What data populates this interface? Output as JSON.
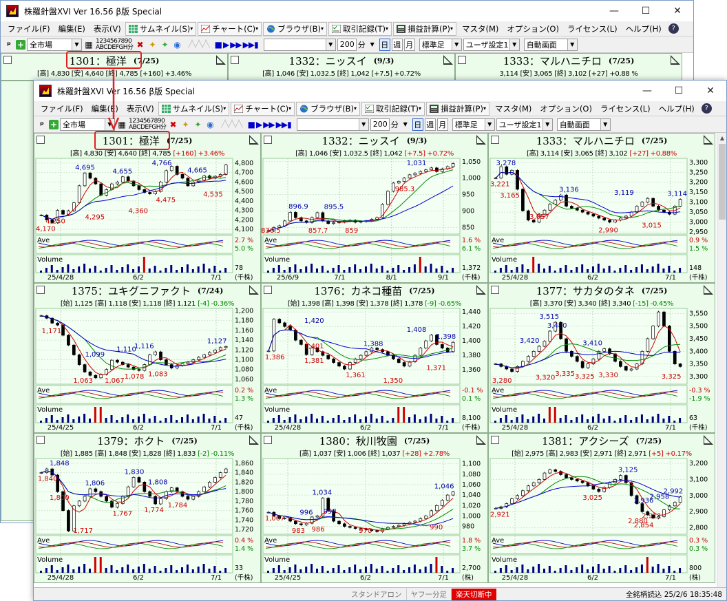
{
  "app": {
    "title": "株羅針盤XVI Ver 16.56 β版  Special",
    "controls": {
      "minimize": "—",
      "maximize": "☐",
      "close": "✕"
    }
  },
  "menus": [
    {
      "label": "ファイル(F)",
      "icon": null
    },
    {
      "label": "編集(E)",
      "icon": null
    },
    {
      "label": "表示(V)",
      "icon": null
    },
    {
      "label": "サムネイル(S)",
      "icon": "grid-icon"
    },
    {
      "label": "チャート(C)",
      "icon": "chart-icon"
    },
    {
      "label": "ブラウザ(B)",
      "icon": "globe-icon"
    },
    {
      "label": "取引記録(T)",
      "icon": "checklist-icon"
    },
    {
      "label": "損益計算(P)",
      "icon": "calc-icon"
    },
    {
      "label": "マスタ(M)",
      "icon": null
    },
    {
      "label": "オプション(O)",
      "icon": null
    },
    {
      "label": "ライセンス(L)",
      "icon": null
    },
    {
      "label": "ヘルプ(H)",
      "icon": null
    }
  ],
  "toolbar": {
    "market": "全市場",
    "digits_top": "1234567890",
    "digits_bottom": "ABCDEFGH分",
    "search_value": "",
    "interval": "200",
    "interval_unit": "分",
    "period_day": "日",
    "period_week": "週",
    "period_month": "月",
    "candle_type": "標準足",
    "user_setting": "ユーザ設定1",
    "auto_screen": "自動画面"
  },
  "panels": [
    {
      "code": "1301",
      "name": "極洋",
      "date": "(7/25)",
      "quote": "[高] 4,830 [安] 4,640 [終] 4,785",
      "chg": "[+160] +3.46%",
      "chg_dir": "up",
      "high_tick": "4,830",
      "ymax": 4850,
      "ymin": 4050,
      "yticks": [
        "4,800",
        "4,700",
        "4,600",
        "4,500",
        "4,400",
        "4,300",
        "4,200",
        "4,100"
      ],
      "xlabels": [
        "25/4/28",
        "6/2",
        "7/1"
      ],
      "ave_l": "2.7 %",
      "ave_r": "5.0 %",
      "vol_v": "78",
      "vol_u": "(千株)",
      "close_series": [
        4250,
        4200,
        4170,
        4300,
        4260,
        4295,
        4380,
        4560,
        4695,
        4640,
        4580,
        4460,
        4520,
        4580,
        4600,
        4655,
        4610,
        4560,
        4520,
        4490,
        4475,
        4500,
        4600,
        4720,
        4766,
        4680,
        4640,
        4560,
        4600,
        4620,
        4665,
        4640,
        4660,
        4680,
        4780
      ],
      "labels_hi": [
        [
          "4,695",
          0.25
        ],
        [
          "4,655",
          0.44
        ],
        [
          "4,766",
          0.64
        ],
        [
          "4,665",
          0.82
        ]
      ],
      "labels_lo": [
        [
          "4,250",
          0.1
        ],
        [
          "4,170",
          0.05
        ],
        [
          "4,295",
          0.3
        ],
        [
          "4,360",
          0.52
        ],
        [
          "4,475",
          0.66
        ],
        [
          "4,535",
          0.9
        ]
      ],
      "vspike": 0.55
    },
    {
      "code": "1332",
      "name": "ニッスイ",
      "date": "(9/3)",
      "quote": "[高] 1,046 [安] 1,032.5 [終] 1,042",
      "chg": "[+7.5] +0.72%",
      "chg_dir": "up",
      "high_tick": "1,046",
      "ymax": 1060,
      "ymin": 830,
      "yticks": [
        "1,050",
        "1,000",
        "950",
        "900",
        "850"
      ],
      "xlabels": [
        "25/6/9",
        "7/1",
        "8/1",
        "9/1"
      ],
      "ave_l": "1.6 %",
      "ave_r": "6.1 %",
      "vol_v": "1,372",
      "vol_u": "(千株)",
      "close_series": [
        840,
        850,
        855,
        870,
        896,
        880,
        870,
        865,
        880,
        895,
        870,
        862,
        865,
        866,
        870,
        872,
        866,
        868,
        870,
        875,
        880,
        920,
        960,
        985,
        990,
        1000,
        1010,
        1015,
        1020,
        1025,
        1031,
        1020,
        1028,
        1035,
        1044
      ],
      "labels_hi": [
        [
          "896.9",
          0.18
        ],
        [
          "895.5",
          0.36
        ],
        [
          "1,031",
          0.78
        ]
      ],
      "labels_lo": [
        [
          "830.5",
          0.04
        ],
        [
          "857.7",
          0.28
        ],
        [
          "859",
          0.45
        ],
        [
          "985.3",
          0.72
        ]
      ],
      "vspike": 0.8
    },
    {
      "code": "1333",
      "name": "マルハニチロ",
      "date": "(7/25)",
      "quote": "[高] 3,114 [安] 3,065 [終] 3,102",
      "chg": "[+27] +0.88%",
      "chg_dir": "up",
      "high_tick": "3,114",
      "ymax": 3320,
      "ymin": 2940,
      "yticks": [
        "3,300",
        "3,250",
        "3,200",
        "3,150",
        "3,100",
        "3,050",
        "3,000",
        "2,950"
      ],
      "xlabels": [
        "25/4/28",
        "6/2",
        "7/1"
      ],
      "ave_l": "0.9 %",
      "ave_r": "1.5 %",
      "vol_v": "148",
      "vol_u": "(千株)",
      "close_series": [
        3221,
        3278,
        3240,
        3260,
        3165,
        3057,
        3010,
        3000,
        3040,
        3060,
        3090,
        3110,
        3136,
        3080,
        3070,
        3060,
        3050,
        3040,
        3030,
        3020,
        3010,
        3000,
        3010,
        3020,
        3030,
        3050,
        3080,
        3100,
        3119,
        3080,
        3060,
        3050,
        3040,
        3080,
        3114
      ],
      "labels_hi": [
        [
          "3,278",
          0.08
        ],
        [
          "3,136",
          0.4
        ],
        [
          "3,119",
          0.68
        ],
        [
          "3,114",
          0.95
        ]
      ],
      "labels_lo": [
        [
          "3,221",
          0.05
        ],
        [
          "3,165",
          0.1
        ],
        [
          "3,057",
          0.25
        ],
        [
          "2,990",
          0.6
        ],
        [
          "3,015",
          0.82
        ]
      ],
      "vspike": 0.2
    },
    {
      "code": "1375",
      "name": "ユキグニファクト",
      "date": "(7/24)",
      "quote": "[始] 1,125 [高] 1,118 [安] 1,118 [終] 1,121",
      "chg": "[-4] -0.36%",
      "chg_dir": "dn",
      "high_tick": "1,125",
      "ymax": 1205,
      "ymin": 1050,
      "yticks": [
        "1,200",
        "1,180",
        "1,160",
        "1,140",
        "1,120",
        "1,100",
        "1,080",
        "1,060"
      ],
      "xlabels": [
        "25/4/25",
        "6/2",
        "7/1"
      ],
      "ave_l": "0.2 %",
      "ave_r": "1.3 %",
      "vol_v": "47",
      "vol_u": "(千株)",
      "close_series": [
        1190,
        1185,
        1175,
        1171,
        1150,
        1130,
        1110,
        1090,
        1075,
        1068,
        1063,
        1070,
        1080,
        1099,
        1095,
        1090,
        1085,
        1080,
        1078,
        1090,
        1110,
        1116,
        1100,
        1090,
        1083,
        1088,
        1092,
        1095,
        1100,
        1105,
        1110,
        1115,
        1120,
        1125,
        1127
      ],
      "labels_hi": [
        [
          "1,099",
          0.3
        ],
        [
          "1,110",
          0.46
        ],
        [
          "1,116",
          0.55
        ],
        [
          "1,127",
          0.92
        ]
      ],
      "labels_lo": [
        [
          "1,171",
          0.08
        ],
        [
          "1,078",
          0.5
        ],
        [
          "1,083",
          0.62
        ],
        [
          "1,063",
          0.24
        ],
        [
          "1,067",
          0.4
        ]
      ],
      "vspike": 0.3
    },
    {
      "code": "1376",
      "name": "カネコ種苗",
      "date": "(7/25)",
      "quote": "[始] 1,398 [高] 1,398 [安] 1,378 [終] 1,378",
      "chg": "[-9] -0.65%",
      "chg_dir": "dn",
      "high_tick": "1,378",
      "ymax": 1445,
      "ymin": 1340,
      "yticks": [
        "1,440",
        "1,420",
        "1,400",
        "1,380",
        "1,360"
      ],
      "xlabels": [
        "25/4/28",
        "6/2",
        "7/1"
      ],
      "ave_l": "-0.1 %",
      "ave_r": "0.1 %",
      "vol_v": "8,100",
      "vol_u": "(千株)",
      "close_series": [
        1386,
        1430,
        1425,
        1420,
        1415,
        1401,
        1395,
        1381,
        1390,
        1385,
        1380,
        1375,
        1370,
        1365,
        1361,
        1370,
        1375,
        1380,
        1385,
        1390,
        1388,
        1385,
        1380,
        1375,
        1370,
        1365,
        1371,
        1380,
        1390,
        1400,
        1408,
        1395,
        1390,
        1385,
        1398
      ],
      "labels_hi": [
        [
          "1,420",
          0.26
        ],
        [
          "1,388",
          0.56
        ],
        [
          "1,408",
          0.78
        ],
        [
          "1,398",
          0.93
        ]
      ],
      "labels_lo": [
        [
          "1,386",
          0.06
        ],
        [
          "1,401",
          0.26
        ],
        [
          "1,381",
          0.26
        ],
        [
          "1,361",
          0.47
        ],
        [
          "1,350",
          0.66
        ],
        [
          "1,371",
          0.88
        ]
      ],
      "vspike": 0.7
    },
    {
      "code": "1377",
      "name": "サカタのタネ",
      "date": "(7/25)",
      "quote": "[高] 3,370 [安] 3,340 [終] 3,340",
      "chg": "[-15] -0.45%",
      "chg_dir": "dn",
      "high_tick": "3,556",
      "ymax": 3570,
      "ymin": 3270,
      "yticks": [
        "3,550",
        "3,500",
        "3,450",
        "3,400",
        "3,350",
        "3,300"
      ],
      "xlabels": [
        "25/4/28",
        "6/2",
        "7/1"
      ],
      "ave_l": "-0.3 %",
      "ave_r": "-1.9 %",
      "vol_v": "63",
      "vol_u": "(千株)",
      "close_series": [
        3350,
        3340,
        3330,
        3320,
        3340,
        3360,
        3380,
        3400,
        3420,
        3440,
        3480,
        3515,
        3450,
        3400,
        3380,
        3360,
        3335,
        3350,
        3370,
        3400,
        3410,
        3390,
        3360,
        3340,
        3325,
        3330,
        3350,
        3400,
        3450,
        3500,
        3556,
        3500,
        3400,
        3350,
        3340
      ],
      "labels_hi": [
        [
          "3,420",
          0.2
        ],
        [
          "3,515",
          0.3
        ],
        [
          "3,480",
          0.34
        ],
        [
          "3,410",
          0.52
        ]
      ],
      "labels_lo": [
        [
          "3,320",
          0.28
        ],
        [
          "3,335",
          0.38
        ],
        [
          "3,325",
          0.48
        ],
        [
          "3,330",
          0.6
        ],
        [
          "3,325",
          0.92
        ],
        [
          "3,280",
          0.06
        ]
      ],
      "vspike": 0.3
    },
    {
      "code": "1379",
      "name": "ホクト",
      "date": "(7/25)",
      "quote": "[始] 1,885 [高] 1,848 [安] 1,828 [終] 1,833",
      "chg": "[-2] -0.11%",
      "chg_dir": "dn",
      "high_tick": "1,848",
      "ymax": 1870,
      "ymin": 1710,
      "yticks": [
        "1,860",
        "1,840",
        "1,820",
        "1,800",
        "1,780",
        "1,760",
        "1,740",
        "1,720"
      ],
      "xlabels": [
        "25/4/28",
        "6/2",
        "7/1"
      ],
      "ave_l": "0.4 %",
      "ave_r": "1.4 %",
      "vol_v": "33",
      "vol_u": "(千株)",
      "close_series": [
        1840,
        1848,
        1835,
        1800,
        1760,
        1717,
        1770,
        1780,
        1790,
        1806,
        1800,
        1790,
        1780,
        1767,
        1775,
        1790,
        1810,
        1830,
        1820,
        1800,
        1790,
        1774,
        1785,
        1800,
        1808,
        1800,
        1790,
        1784,
        1790,
        1800,
        1810,
        1820,
        1830,
        1840,
        1848
      ],
      "labels_hi": [
        [
          "1,848",
          0.12
        ],
        [
          "1,806",
          0.3
        ],
        [
          "1,830",
          0.5
        ],
        [
          "1,808",
          0.62
        ]
      ],
      "labels_lo": [
        [
          "1,840",
          0.06
        ],
        [
          "1,800",
          0.12
        ],
        [
          "1,767",
          0.44
        ],
        [
          "1,774",
          0.6
        ],
        [
          "1,784",
          0.72
        ],
        [
          "1,717",
          0.24
        ]
      ],
      "vspike": 0.3
    },
    {
      "code": "1380",
      "name": "秋川牧園",
      "date": "(7/25)",
      "quote": "[高] 1,037 [安] 1,006 [終] 1,037",
      "chg": "[+28] +2.78%",
      "chg_dir": "up",
      "high_tick": "1,105",
      "ymax": 1110,
      "ymin": 965,
      "yticks": [
        "1,100",
        "1,080",
        "1,060",
        "1,040",
        "1,020",
        "1,000",
        "980"
      ],
      "xlabels": [
        "25/4/25",
        "6/2",
        "7/1"
      ],
      "ave_l": "1.8 %",
      "ave_r": "3.7 %",
      "vol_v": "2,700",
      "vol_u": "(株)",
      "close_series": [
        1007,
        1000,
        995,
        996,
        990,
        985,
        983,
        986,
        998,
        1000,
        1034,
        1010,
        990,
        985,
        980,
        978,
        976,
        975,
        974,
        972,
        970,
        975,
        978,
        980,
        982,
        985,
        988,
        990,
        995,
        1000,
        1010,
        1020,
        1030,
        1040,
        1046
      ],
      "labels_hi": [
        [
          "996",
          0.22
        ],
        [
          "998",
          0.34
        ],
        [
          "1,034",
          0.3
        ],
        [
          "1,046",
          0.92
        ]
      ],
      "labels_lo": [
        [
          "1,007",
          0.06
        ],
        [
          "983",
          0.18
        ],
        [
          "986",
          0.28
        ],
        [
          "970",
          0.52
        ],
        [
          "990",
          0.88
        ]
      ],
      "vspike": 0.88
    },
    {
      "code": "1381",
      "name": "アクシーズ",
      "date": "(7/25)",
      "quote": "[始] 2,975 [高] 2,983 [安] 2,971 [終] 2,971",
      "chg": "[+5] +0.17%",
      "chg_dir": "up",
      "high_tick": "2,971",
      "ymax": 3230,
      "ymin": 2760,
      "yticks": [
        "3,200",
        "3,100",
        "3,000",
        "2,900",
        "2,800"
      ],
      "xlabels": [
        "25/4/28",
        "6/2",
        "7/1"
      ],
      "ave_l": "0.3 %",
      "ave_r": "0.3 %",
      "vol_v": "800",
      "vol_u": "(株)",
      "close_series": [
        2921,
        2930,
        2950,
        2980,
        3000,
        3030,
        3060,
        3080,
        3100,
        3140,
        3160,
        3150,
        3130,
        3110,
        3100,
        3090,
        3080,
        3060,
        3040,
        3025,
        3050,
        3080,
        3100,
        3125,
        3080,
        3000,
        2950,
        2900,
        2880,
        2860,
        2870,
        2911,
        2936,
        2958,
        2992
      ],
      "labels_hi": [
        [
          "3,125",
          0.7
        ],
        [
          "2,936",
          0.78
        ],
        [
          "2,958",
          0.86
        ],
        [
          "2,992",
          0.93
        ]
      ],
      "labels_lo": [
        [
          "2,921",
          0.05
        ],
        [
          "3,025",
          0.52
        ],
        [
          "2,880",
          0.75
        ],
        [
          "2,854",
          0.78
        ],
        [
          "2,911",
          0.82
        ]
      ],
      "vspike": 0.8
    }
  ],
  "back_panels": [
    {
      "code": "1301",
      "name": "極洋",
      "date": "(7/25)",
      "quote": "[高] 4,830 [安] 4,640 [終] 4,785 [+160] +3.46%"
    },
    {
      "code": "1332",
      "name": "ニッスイ",
      "date": "(9/3)",
      "quote": "[高] 1,046 [安] 1,032.5 [終] 1,042 [+7.5] +0.72%"
    },
    {
      "code": "1333",
      "name": "マルハニチロ",
      "date": "(7/25)",
      "quote": "3,114 [安] 3,065 [終] 3,102 [+27] +0.88 %"
    }
  ],
  "status": {
    "standalone": "スタンドアロン",
    "yahoo": "ヤフー分足",
    "rakuten": "楽天切断中",
    "right": "全銘柄読込  25/2/6  18:35:48"
  },
  "labels": {
    "ave": "Ave",
    "volume": "Volume"
  },
  "colors": {
    "panel_bg": "#ebfceb",
    "candle_up": "#000000",
    "ma_short": "#cc0000",
    "ma_mid": "#008800",
    "ma_long": "#0000cc",
    "highlight": "#e02020"
  }
}
